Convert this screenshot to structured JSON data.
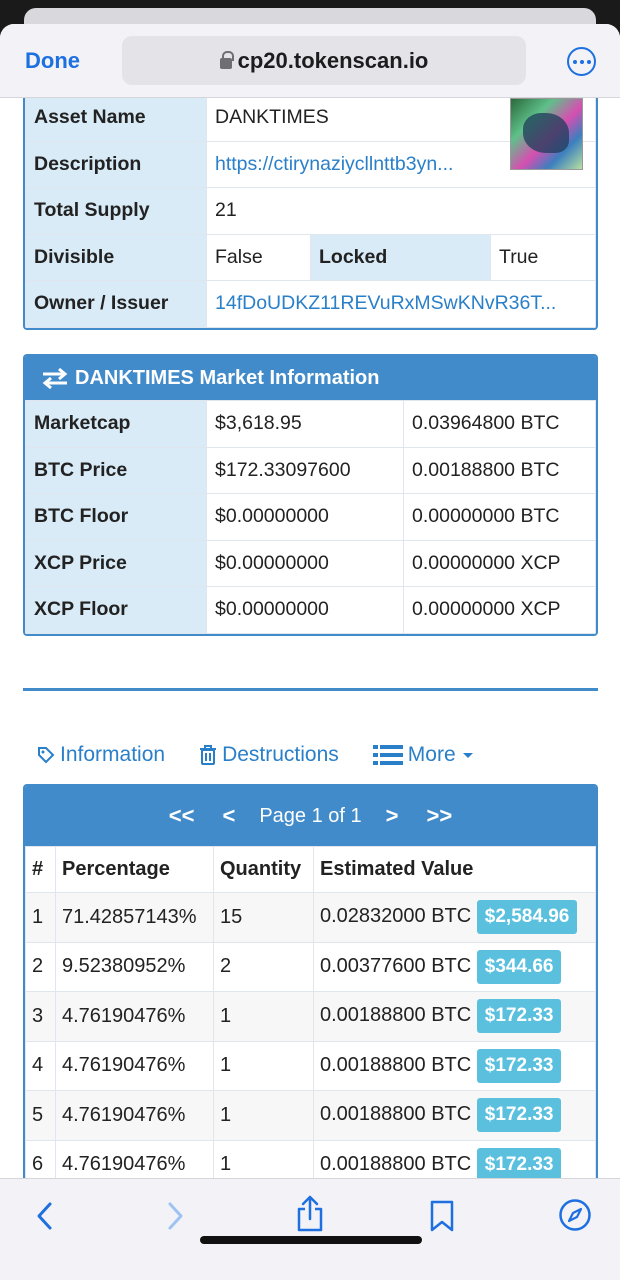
{
  "browser": {
    "done_label": "Done",
    "url": "cp20.tokenscan.io"
  },
  "asset": {
    "rows": [
      {
        "label": "Asset Name",
        "value": "DANKTIMES"
      },
      {
        "label": "Description",
        "value": "https://ctirynaziycllnttb3yn..."
      },
      {
        "label": "Total Supply",
        "value": "21"
      }
    ],
    "divisible_label": "Divisible",
    "divisible_value": "False",
    "locked_label": "Locked",
    "locked_value": "True",
    "owner_label": "Owner / Issuer",
    "owner_value": "14fDoUDKZ11REVuRxMSwKNvR36T..."
  },
  "market": {
    "title": "DANKTIMES Market Information",
    "rows": [
      {
        "label": "Marketcap",
        "usd": "$3,618.95",
        "alt": "0.03964800 BTC"
      },
      {
        "label": "BTC Price",
        "usd": "$172.33097600",
        "alt": "0.00188800 BTC"
      },
      {
        "label": "BTC Floor",
        "usd": "$0.00000000",
        "alt": "0.00000000 BTC"
      },
      {
        "label": "XCP Price",
        "usd": "$0.00000000",
        "alt": "0.00000000 XCP"
      },
      {
        "label": "XCP Floor",
        "usd": "$0.00000000",
        "alt": "0.00000000 XCP"
      }
    ]
  },
  "tabs": {
    "information": "Information",
    "destructions": "Destructions",
    "more": "More"
  },
  "holders": {
    "pager": {
      "first": "<<",
      "prev": "<",
      "label": "Page 1 of 1",
      "next": ">",
      "last": ">>"
    },
    "headers": {
      "num": "#",
      "percentage": "Percentage",
      "quantity": "Quantity",
      "value": "Estimated Value"
    },
    "rows": [
      {
        "num": "1",
        "pct": "71.42857143%",
        "qty": "15",
        "btc": "0.02832000 BTC",
        "usd": "$2,584.96"
      },
      {
        "num": "2",
        "pct": "9.52380952%",
        "qty": "2",
        "btc": "0.00377600 BTC",
        "usd": "$344.66"
      },
      {
        "num": "3",
        "pct": "4.76190476%",
        "qty": "1",
        "btc": "0.00188800 BTC",
        "usd": "$172.33"
      },
      {
        "num": "4",
        "pct": "4.76190476%",
        "qty": "1",
        "btc": "0.00188800 BTC",
        "usd": "$172.33"
      },
      {
        "num": "5",
        "pct": "4.76190476%",
        "qty": "1",
        "btc": "0.00188800 BTC",
        "usd": "$172.33"
      },
      {
        "num": "6",
        "pct": "4.76190476%",
        "qty": "1",
        "btc": "0.00188800 BTC",
        "usd": "$172.33"
      }
    ]
  },
  "colors": {
    "accent": "#428bca",
    "label_bg": "#d9ebf7",
    "badge": "#5bc0de",
    "ios_blue": "#1e6fe0"
  }
}
